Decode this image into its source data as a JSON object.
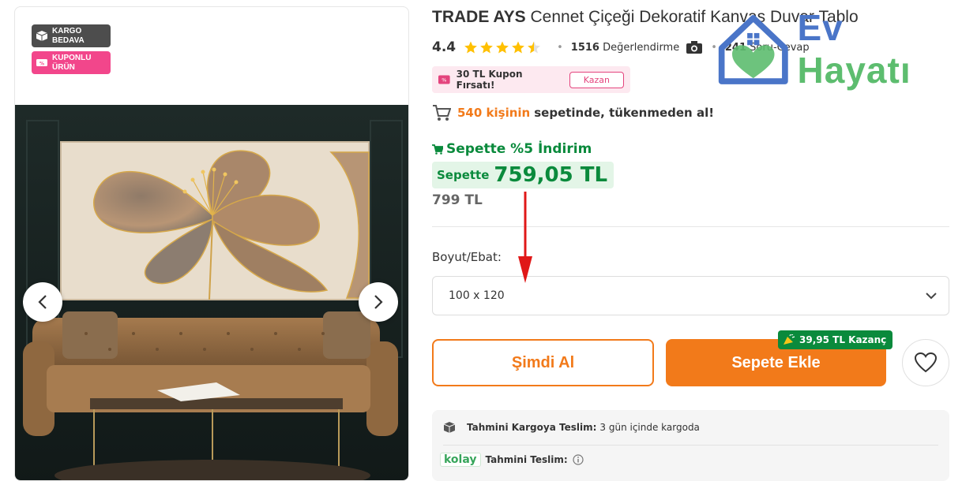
{
  "gallery": {
    "badges": [
      {
        "label": "KARGO BEDAVA",
        "icon": "box-icon",
        "color": "#4d4d4d"
      },
      {
        "label": "KUPONLU ÜRÜN",
        "icon": "coupon-icon",
        "color": "#f2468b"
      }
    ],
    "prev_icon": "chevron-left-icon",
    "next_icon": "chevron-right-icon"
  },
  "product": {
    "brand": "TRADE AYS",
    "name": "Cennet Çiçeği Dekoratif Kanvas Duvar Tablo",
    "rating": "4.4",
    "rating_stars": 4.5,
    "review_count": "1516",
    "review_label": "Değerlendirme",
    "qa_count": "241",
    "qa_label": "Soru-Cevap"
  },
  "coupon": {
    "text": "30 TL Kupon Fırsatı!",
    "button": "Kazan"
  },
  "basket_info": {
    "count": "540 kişinin",
    "text": "sepetinde, tükenmeden al!"
  },
  "pricing": {
    "discount_text": "Sepette %5 İndirim",
    "price_label": "Sepette",
    "price": "759,05 TL",
    "old_price": "799 TL"
  },
  "variant": {
    "label": "Boyut/Ebat:",
    "selected": "100 x 120"
  },
  "actions": {
    "buy_now": "Şimdi Al",
    "add_to_cart": "Sepete Ekle",
    "earn_badge": "39,95 TL Kazanç",
    "favorite_icon": "heart-icon"
  },
  "delivery": {
    "cargo_label": "Tahmini Kargoya Teslim:",
    "cargo_value": "3 gün içinde kargoda",
    "kolay": "kolay",
    "delivery_label": "Tahmini Teslim:"
  },
  "watermark": {
    "ev": "Ev",
    "hayati": "Hayatı"
  },
  "colors": {
    "accent": "#f27a1a",
    "green": "#0a8a3c",
    "pink": "#f2468b",
    "logo_blue": "#4a75c8",
    "logo_green": "#5dbd6f"
  }
}
